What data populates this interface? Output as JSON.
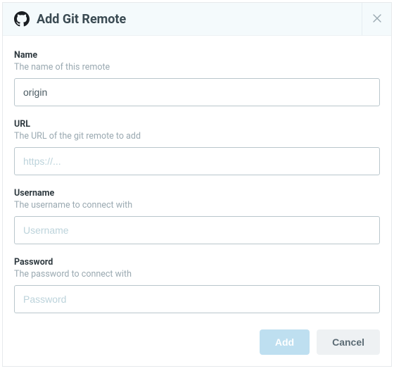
{
  "header": {
    "title": "Add Git Remote"
  },
  "fields": {
    "name": {
      "label": "Name",
      "help": "The name of this remote",
      "value": "origin",
      "placeholder": ""
    },
    "url": {
      "label": "URL",
      "help": "The URL of the git remote to add",
      "value": "",
      "placeholder": "https://..."
    },
    "username": {
      "label": "Username",
      "help": "The username to connect with",
      "value": "",
      "placeholder": "Username"
    },
    "password": {
      "label": "Password",
      "help": "The password to connect with",
      "value": "",
      "placeholder": "Password"
    }
  },
  "actions": {
    "add": "Add",
    "cancel": "Cancel"
  }
}
